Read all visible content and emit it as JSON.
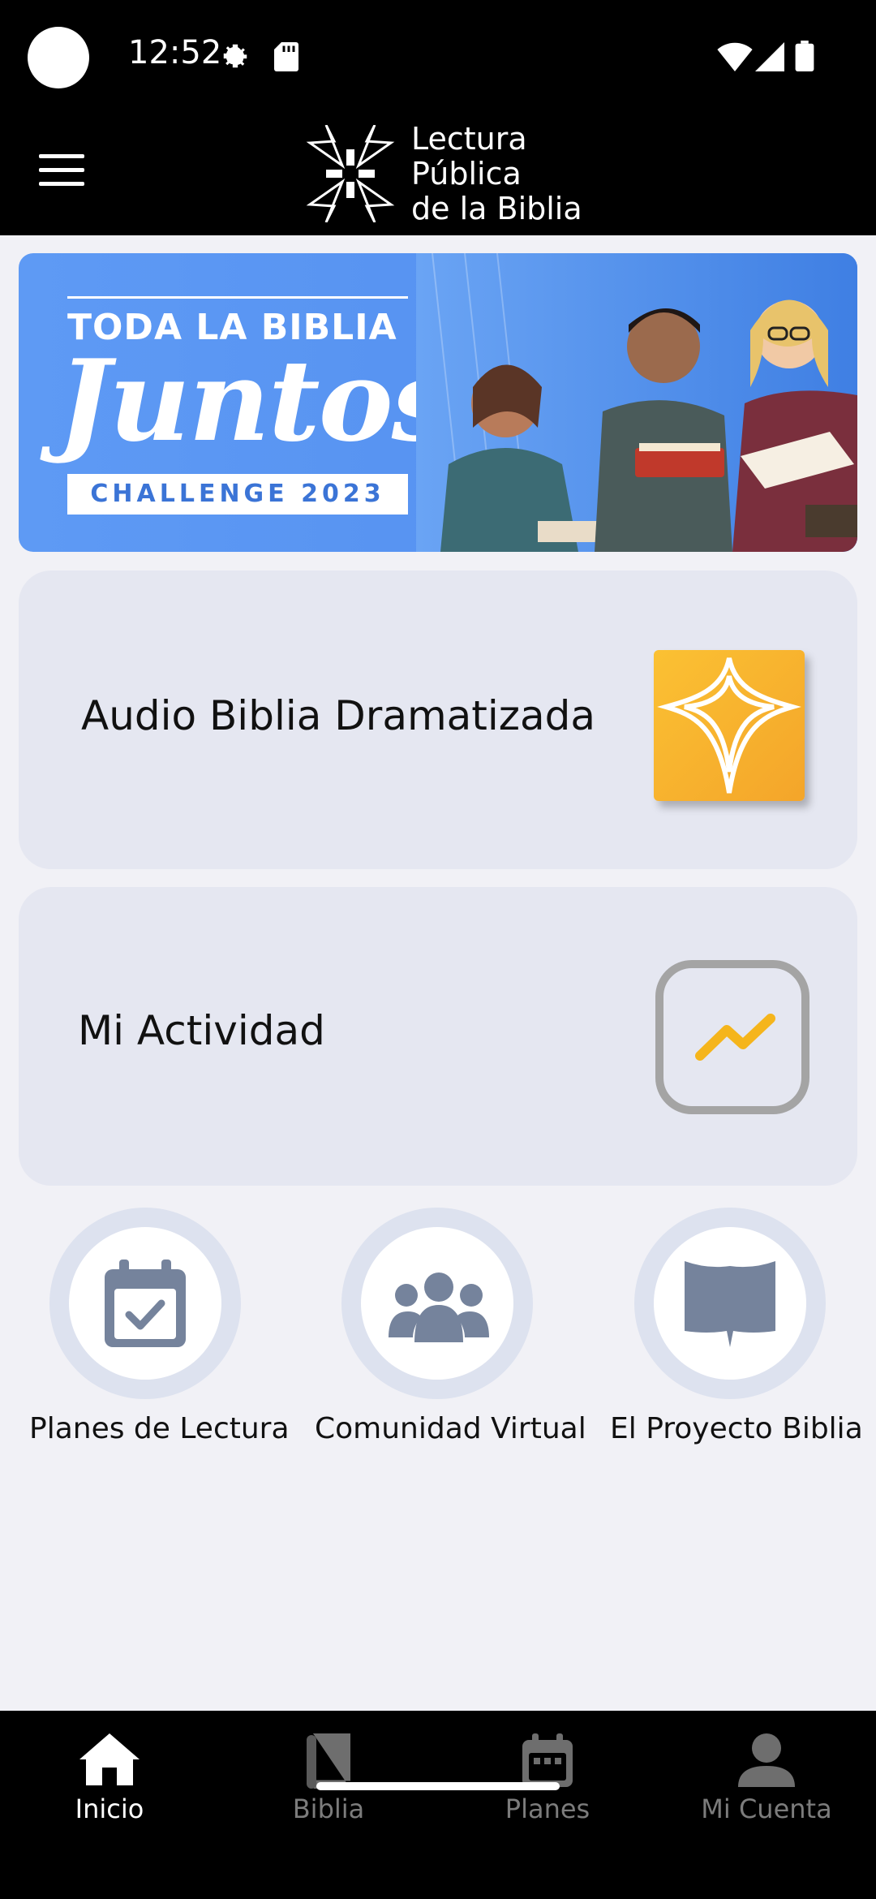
{
  "status_bar": {
    "time": "12:52",
    "icons": [
      "settings-icon",
      "sd-card-icon",
      "wifi-icon",
      "signal-icon",
      "battery-icon"
    ]
  },
  "app_bar": {
    "menu_icon": "menu-icon",
    "logo_lines": [
      "Lectura",
      "Pública",
      "de la Biblia"
    ]
  },
  "banner": {
    "line1": "TODA LA BIBLIA",
    "line2": "Juntos",
    "line3": "CHALLENGE 2023"
  },
  "cards": {
    "audio": {
      "label": "Audio Biblia Dramatizada",
      "icon": "cross-app-icon"
    },
    "activity": {
      "label": "Mi Actividad",
      "icon": "activity-chart-icon"
    }
  },
  "quick_links": [
    {
      "label": "Planes de Lectura",
      "icon": "calendar-check-icon"
    },
    {
      "label": "Comunidad Virtual",
      "icon": "users-icon"
    },
    {
      "label": "El Proyecto Biblia",
      "icon": "open-book-icon"
    }
  ],
  "bottom_nav": {
    "items": [
      {
        "label": "Inicio",
        "icon": "home-icon",
        "active": true
      },
      {
        "label": "Biblia",
        "icon": "book-icon",
        "active": false
      },
      {
        "label": "Planes",
        "icon": "calendar-icon",
        "active": false
      },
      {
        "label": "Mi Cuenta",
        "icon": "person-icon",
        "active": false
      }
    ]
  },
  "colors": {
    "background": "#f1f1f6",
    "card": "#e5e7f1",
    "banner_blue": "#5894f2",
    "accent_orange": "#f4a52a",
    "icon_gray_blue": "#7c8aa4",
    "nav_active": "#ffffff",
    "nav_inactive": "#8a8a8a"
  }
}
